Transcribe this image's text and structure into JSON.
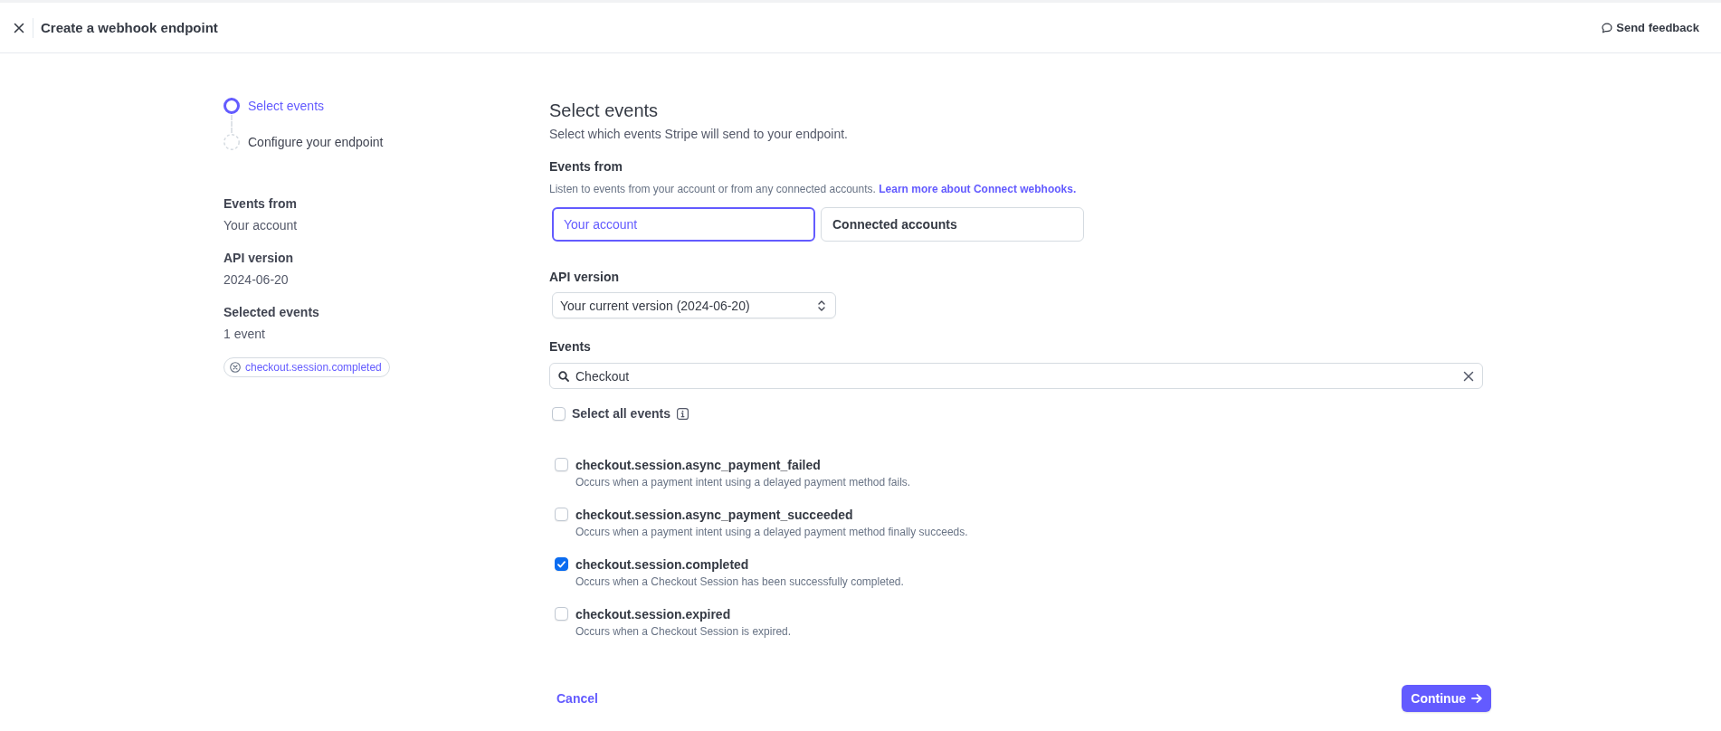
{
  "header": {
    "title": "Create a webhook endpoint",
    "feedback": "Send feedback"
  },
  "steps": [
    {
      "label": "Select events",
      "selected": true
    },
    {
      "label": "Configure your endpoint",
      "selected": false
    }
  ],
  "summary": {
    "items": [
      {
        "label": "Events from",
        "value": "Your account"
      },
      {
        "label": "API version",
        "value": "2024-06-20"
      },
      {
        "label": "Selected events",
        "value": "1 event"
      }
    ],
    "chips": [
      "checkout.session.completed"
    ]
  },
  "form": {
    "title": "Select events",
    "subtitle": "Select which events Stripe will send to your endpoint.",
    "events_from": {
      "label": "Events from",
      "hint": "Listen to events from your account or from any connected accounts.",
      "link": "Learn more about Connect webhooks.",
      "options": [
        {
          "label": "Your account",
          "selected": true
        },
        {
          "label": "Connected accounts",
          "selected": false
        }
      ]
    },
    "api_version": {
      "label": "API version",
      "value": "Your current version (2024-06-20)"
    },
    "events": {
      "label": "Events",
      "search": {
        "value": "Checkout"
      },
      "select_all": {
        "label": "Select all events",
        "checked": false
      },
      "items": [
        {
          "name": "checkout.session.async_payment_failed",
          "description": "Occurs when a payment intent using a delayed payment method fails.",
          "checked": false
        },
        {
          "name": "checkout.session.async_payment_succeeded",
          "description": "Occurs when a payment intent using a delayed payment method finally succeeds.",
          "checked": false
        },
        {
          "name": "checkout.session.completed",
          "description": "Occurs when a Checkout Session has been successfully completed.",
          "checked": true
        },
        {
          "name": "checkout.session.expired",
          "description": "Occurs when a Checkout Session is expired.",
          "checked": false
        }
      ]
    }
  },
  "actions": {
    "cancel": "Cancel",
    "continue": "Continue"
  }
}
